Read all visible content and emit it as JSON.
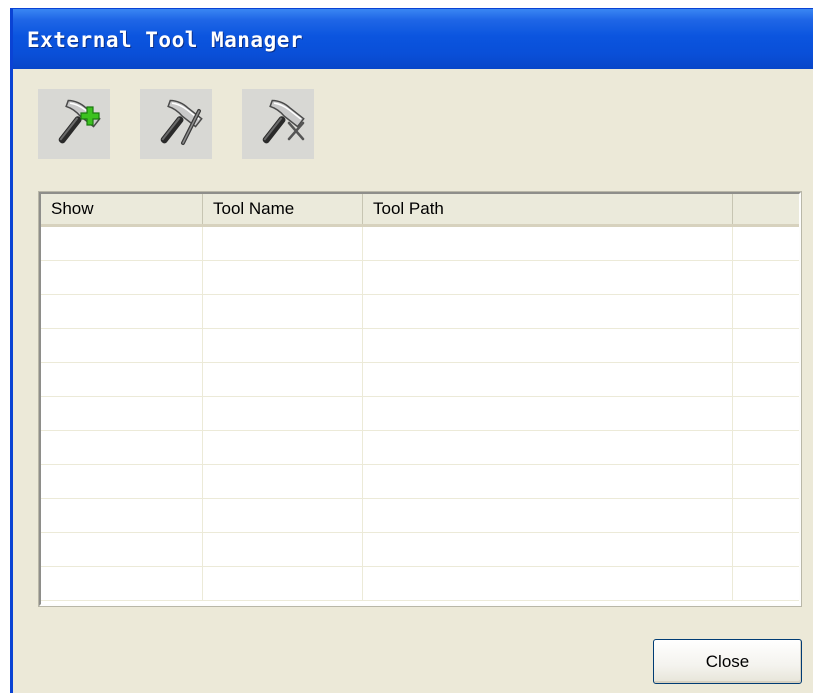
{
  "window": {
    "title": "External Tool Manager"
  },
  "toolbar": {
    "buttons": [
      {
        "name": "add-tool-button",
        "icon": "hammer-add-icon"
      },
      {
        "name": "edit-tool-button",
        "icon": "hammer-edit-icon"
      },
      {
        "name": "remove-tool-button",
        "icon": "hammer-remove-icon"
      }
    ]
  },
  "grid": {
    "columns": [
      "Show",
      "Tool Name",
      "Tool Path",
      ""
    ],
    "rows": [],
    "empty_row_count": 11
  },
  "footer": {
    "close_label": "Close"
  },
  "colors": {
    "title_bar": "#0a4fd8",
    "dialog_background": "#ece9d8",
    "add_icon_accent": "#3cc21f"
  }
}
